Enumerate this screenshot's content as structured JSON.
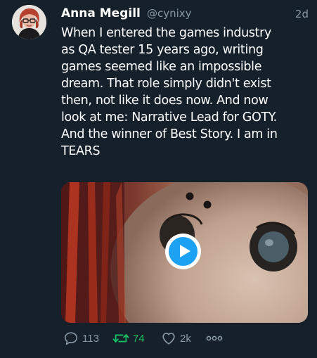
{
  "tweet": {
    "author_name": "Anna Megill",
    "handle": "@cynixy",
    "time": "2d",
    "text": "When I entered the games industry\nas QA tester 15 years ago, writing\ngames seemed like an impossible\ndream. That role simply didn't exist\nthen, not like it does now. And now\nlook at me: Narrative Lead for GOTY.\nAnd the winner of Best Story. I am in\nTEARS"
  },
  "media": {
    "type": "video",
    "play_icon": "play-icon"
  },
  "actions": {
    "reply_count": "113",
    "retweet_count": "74",
    "like_count": "2k",
    "reply_icon": "reply-icon",
    "retweet_icon": "retweet-icon",
    "like_icon": "heart-icon",
    "more_icon": "more-icon"
  },
  "colors": {
    "background": "#15202b",
    "secondary_text": "#8899a6",
    "accent": "#1da1f2",
    "retweeted": "#17bf63"
  }
}
